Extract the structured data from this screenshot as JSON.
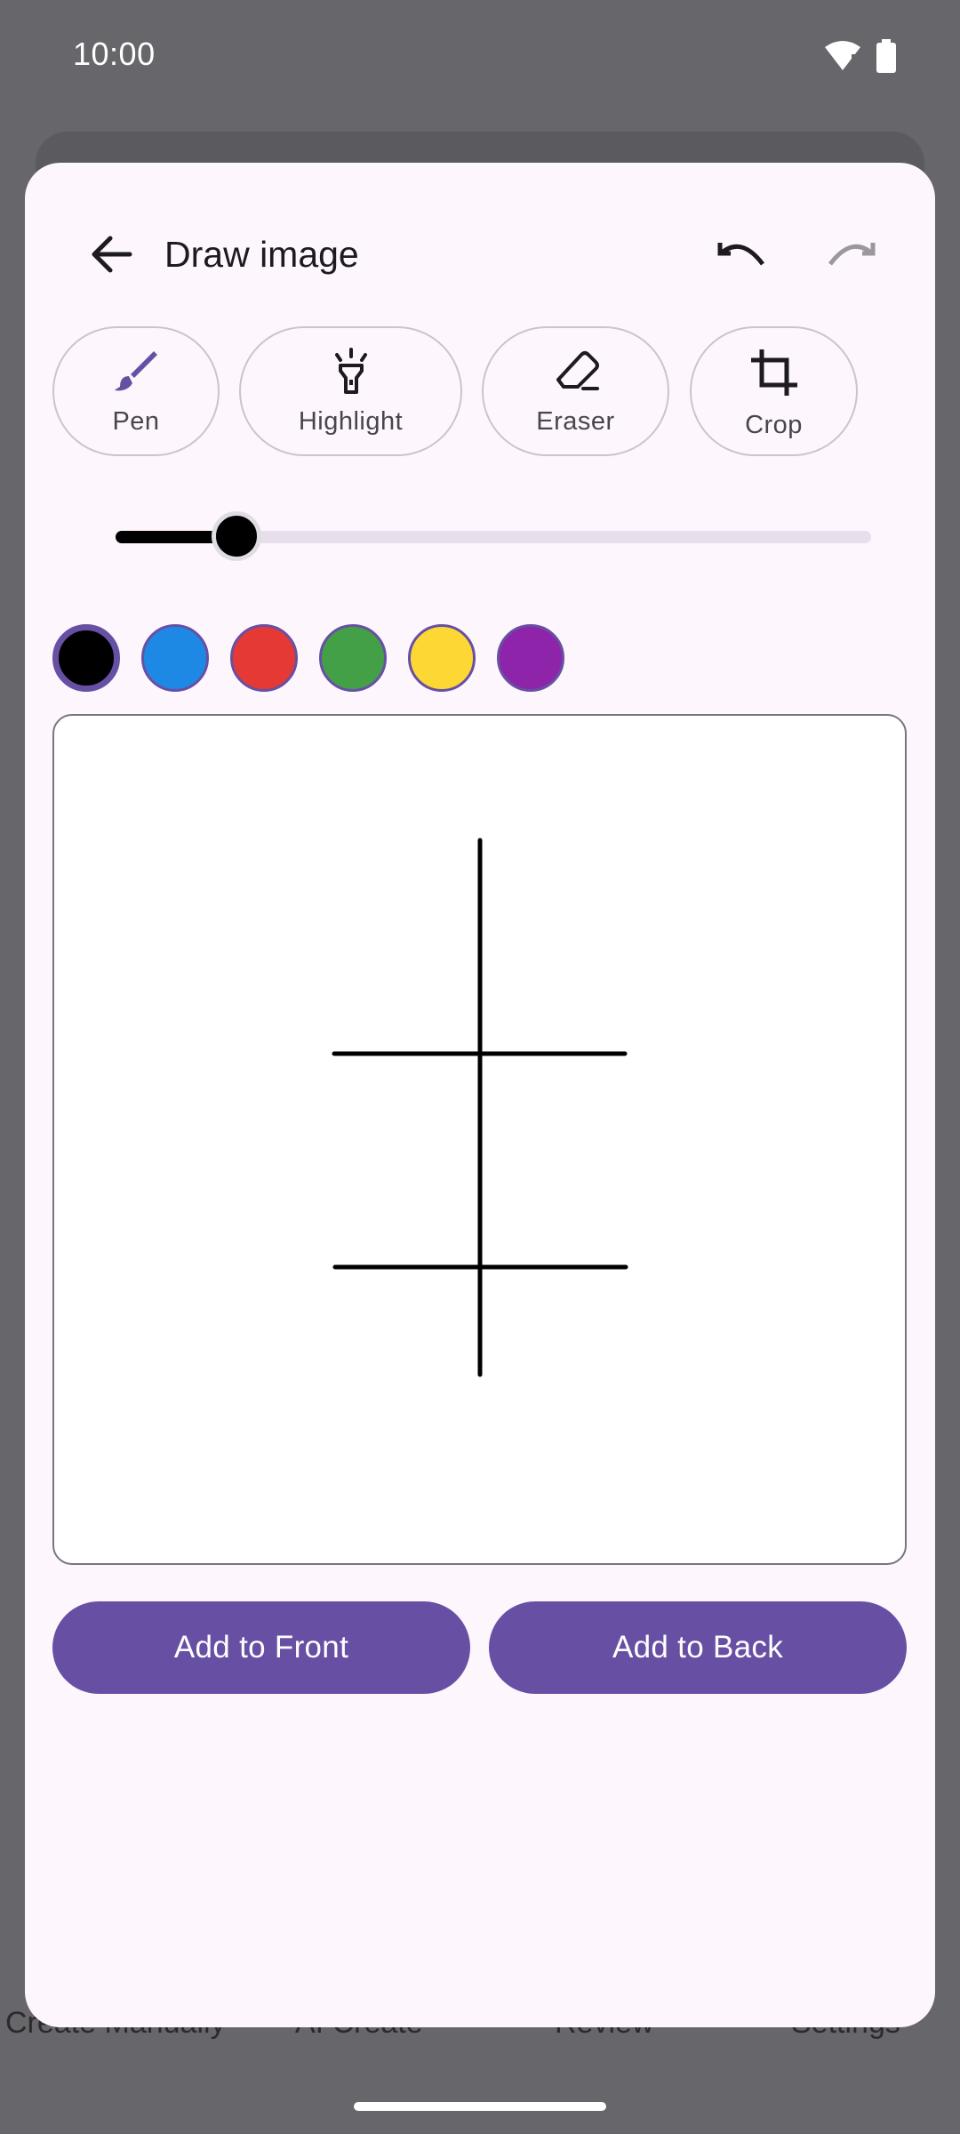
{
  "status_bar": {
    "time": "10:00",
    "wifi_icon": "wifi-icon",
    "battery_icon": "battery-icon"
  },
  "background_nav": {
    "items": [
      "Create Manually",
      "AI Create",
      "Review",
      "Settings"
    ]
  },
  "dialog": {
    "title": "Draw image",
    "back_icon": "arrow-back-icon",
    "undo_icon": "undo-icon",
    "redo_icon": "redo-icon",
    "tools": [
      {
        "label": "Pen",
        "icon": "brush-icon",
        "selected": true
      },
      {
        "label": "Highlight",
        "icon": "highlighter-icon",
        "selected": false
      },
      {
        "label": "Eraser",
        "icon": "eraser-icon",
        "selected": false
      },
      {
        "label": "Crop",
        "icon": "crop-icon",
        "selected": false
      }
    ],
    "stroke_size": {
      "value_fraction": 0.16
    },
    "colors": [
      {
        "name": "black",
        "hex": "#000000",
        "selected": true
      },
      {
        "name": "blue",
        "hex": "#1e88e5",
        "selected": false
      },
      {
        "name": "red",
        "hex": "#e53935",
        "selected": false
      },
      {
        "name": "green",
        "hex": "#43a047",
        "selected": false
      },
      {
        "name": "yellow",
        "hex": "#fdd835",
        "selected": false
      },
      {
        "name": "purple",
        "hex": "#8e24aa",
        "selected": false
      }
    ],
    "actions": {
      "add_front": "Add to Front",
      "add_back": "Add to Back"
    }
  },
  "theme": {
    "accent": "#6750a4",
    "dialog_bg": "#fdf6fd",
    "scrim": "#67666a"
  }
}
